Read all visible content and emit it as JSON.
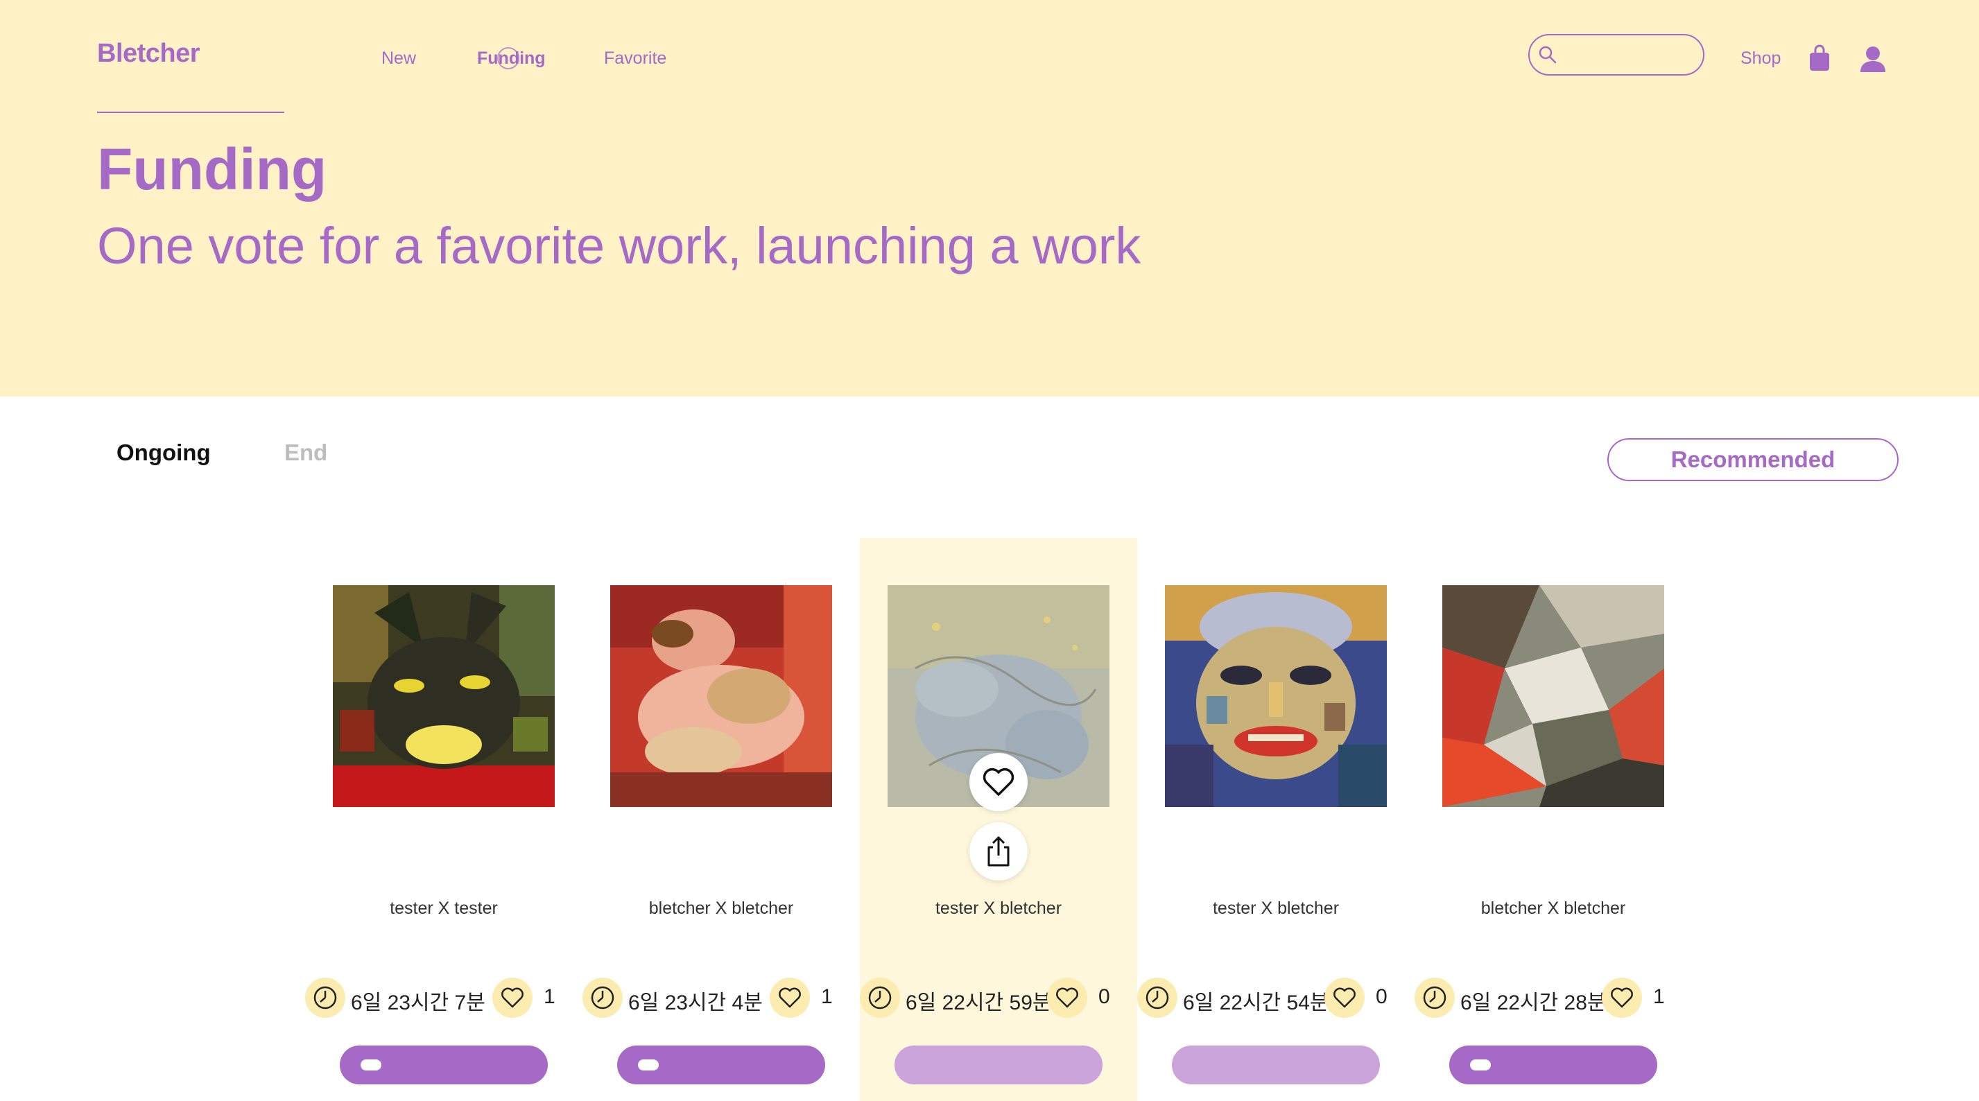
{
  "header": {
    "logo": "Bletcher",
    "nav": [
      "New",
      "Funding",
      "Favorite"
    ],
    "active_nav": "Funding",
    "search_placeholder": "",
    "shop_label": "Shop"
  },
  "hero": {
    "title": "Funding",
    "subtitle": "One vote for a favorite work, launching a work"
  },
  "tabs": [
    "Ongoing",
    "End"
  ],
  "active_tab": "Ongoing",
  "sort_label": "Recommended",
  "colors": {
    "accent": "#a569c6",
    "accent_light": "#cba4db",
    "hero_bg": "#fef2c6",
    "icon_bg": "#fcecb0"
  },
  "cards": [
    {
      "title": "tester X tester",
      "time": "6일 23시간 7분",
      "likes": "1",
      "progress": 0.05,
      "icon": "cat-painting"
    },
    {
      "title": "bletcher X bletcher",
      "time": "6일 23시간 4분",
      "likes": "1",
      "progress": 0.05,
      "icon": "figure-painting"
    },
    {
      "title": "tester X bletcher",
      "time": "6일 22시간 59분",
      "likes": "0",
      "progress": 0,
      "icon": "abstract-painting"
    },
    {
      "title": "tester X bletcher",
      "time": "6일 22시간 54분",
      "likes": "0",
      "progress": 0,
      "icon": "portrait-painting"
    },
    {
      "title": "bletcher X bletcher",
      "time": "6일 22시간 28분",
      "likes": "1",
      "progress": 0.05,
      "icon": "abstract-painting"
    }
  ]
}
